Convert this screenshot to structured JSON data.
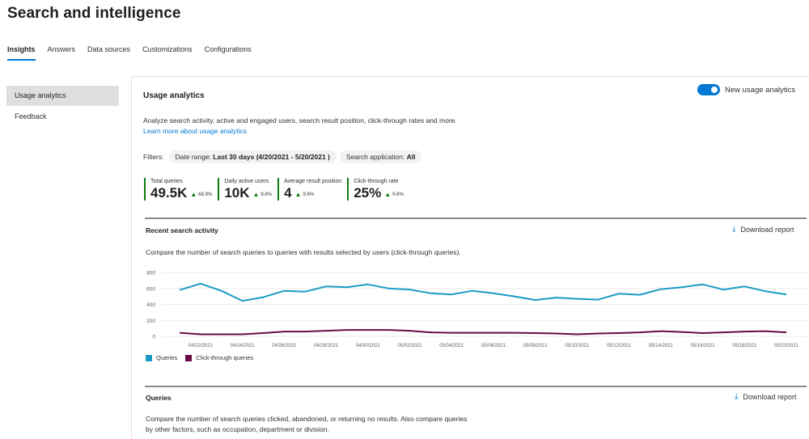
{
  "page": {
    "title": "Search and intelligence"
  },
  "tabs": [
    {
      "label": "Insights",
      "active": true
    },
    {
      "label": "Answers"
    },
    {
      "label": "Data sources"
    },
    {
      "label": "Customizations"
    },
    {
      "label": "Configurations"
    }
  ],
  "sidebar": {
    "items": [
      {
        "label": "Usage analytics",
        "active": true
      },
      {
        "label": "Feedback"
      }
    ]
  },
  "usage": {
    "title": "Usage analytics",
    "toggle_label": "New usage analytics",
    "toggle_on": true,
    "description": "Analyze search activity, active and engaged users, search result position, click-through rates and more.",
    "link": "Learn more about usage analytics"
  },
  "filters": {
    "label": "Filters:",
    "date_label": "Date range:",
    "date_value": "Last 30 days (4/20/2021 - 5/20/2021 )",
    "app_label": "Search application:",
    "app_value": "All"
  },
  "kpis": [
    {
      "label": "Total queries",
      "value": "49.5K",
      "delta": "68.9%"
    },
    {
      "label": "Daily active users",
      "value": "10K",
      "delta": "9.6%"
    },
    {
      "label": "Average result position",
      "value": "4",
      "delta": "9.6%"
    },
    {
      "label": "Click-through rate",
      "value": "25%",
      "delta": "9.6%"
    }
  ],
  "recent": {
    "title": "Recent search activity",
    "download": "Download report",
    "description": "Compare the number of search queries to queries with results selected by users (click-through queries)."
  },
  "queries": {
    "title": "Queries",
    "download": "Download report",
    "description": "Compare the number of search queries clicked, abandoned, or returning no results. Also compare queries by other factors, such as occupation, department or division."
  },
  "colors": {
    "accent": "#0078d4",
    "queries": "#1a9bc6",
    "clickthrough": "#6b0b45",
    "positive": "#107c10"
  },
  "chart_data": {
    "type": "line",
    "x": [
      "04/21",
      "04/22",
      "04/23",
      "04/24",
      "04/25",
      "04/26",
      "04/27",
      "04/28",
      "04/29",
      "04/30",
      "05/01",
      "05/02",
      "05/03",
      "05/04",
      "05/05",
      "05/06",
      "05/07",
      "05/08",
      "05/09",
      "05/10",
      "05/11",
      "05/12",
      "05/13",
      "05/14",
      "05/15",
      "05/16",
      "05/17",
      "05/18",
      "05/19",
      "05/20"
    ],
    "tick_labels": [
      "04/22/2021",
      "04/24/2021",
      "04/26/2021",
      "04/28/2021",
      "04/30/2021",
      "05/02/2021",
      "05/04/2021",
      "05/06/2021",
      "05/08/2021",
      "05/10/2021",
      "05/12/2021",
      "05/14/2021",
      "05/16/2021",
      "05/18/2021",
      "05/20/2021"
    ],
    "y_ticks": [
      "0",
      "200",
      "400",
      "600",
      "800"
    ],
    "ylim": [
      0,
      800
    ],
    "grid": true,
    "series": [
      {
        "name": "Queries",
        "values": [
          580,
          660,
          570,
          445,
          490,
          570,
          560,
          625,
          615,
          650,
          600,
          585,
          540,
          525,
          570,
          540,
          500,
          455,
          485,
          470,
          460,
          535,
          520,
          590,
          615,
          650,
          585,
          625,
          565,
          525
        ]
      },
      {
        "name": "Click-through queries",
        "values": [
          45,
          25,
          25,
          25,
          40,
          60,
          60,
          70,
          80,
          80,
          80,
          70,
          50,
          45,
          45,
          45,
          45,
          40,
          35,
          25,
          35,
          40,
          50,
          65,
          55,
          40,
          50,
          60,
          65,
          50
        ]
      }
    ]
  }
}
